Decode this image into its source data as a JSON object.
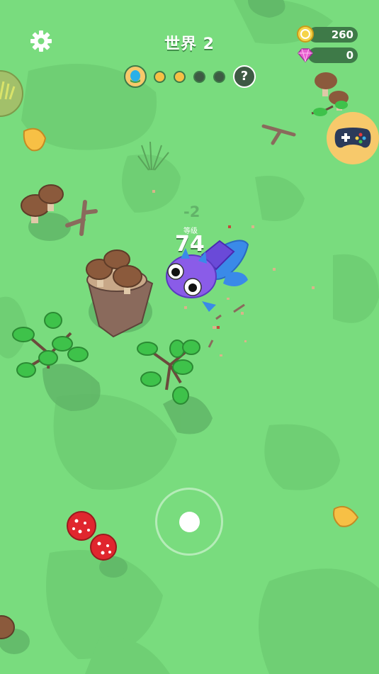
{
  "hud": {
    "world_title": "世界 2",
    "coins": "260",
    "gems": "0",
    "stage_progress": {
      "completed": 2,
      "total": 4,
      "final_marker": "?"
    }
  },
  "player": {
    "level_label": "等级",
    "hp": "74",
    "damage_popup": "-2"
  },
  "colors": {
    "ground": "#79dc7e",
    "coin": "#f5d349",
    "gem": "#e85fd0",
    "player": "#8a5ce8",
    "accent": "#f7c96b"
  },
  "icons": [
    "gear-icon",
    "coin-icon",
    "gem-icon",
    "egg-icon",
    "gamepad-icon",
    "grass-icon"
  ]
}
